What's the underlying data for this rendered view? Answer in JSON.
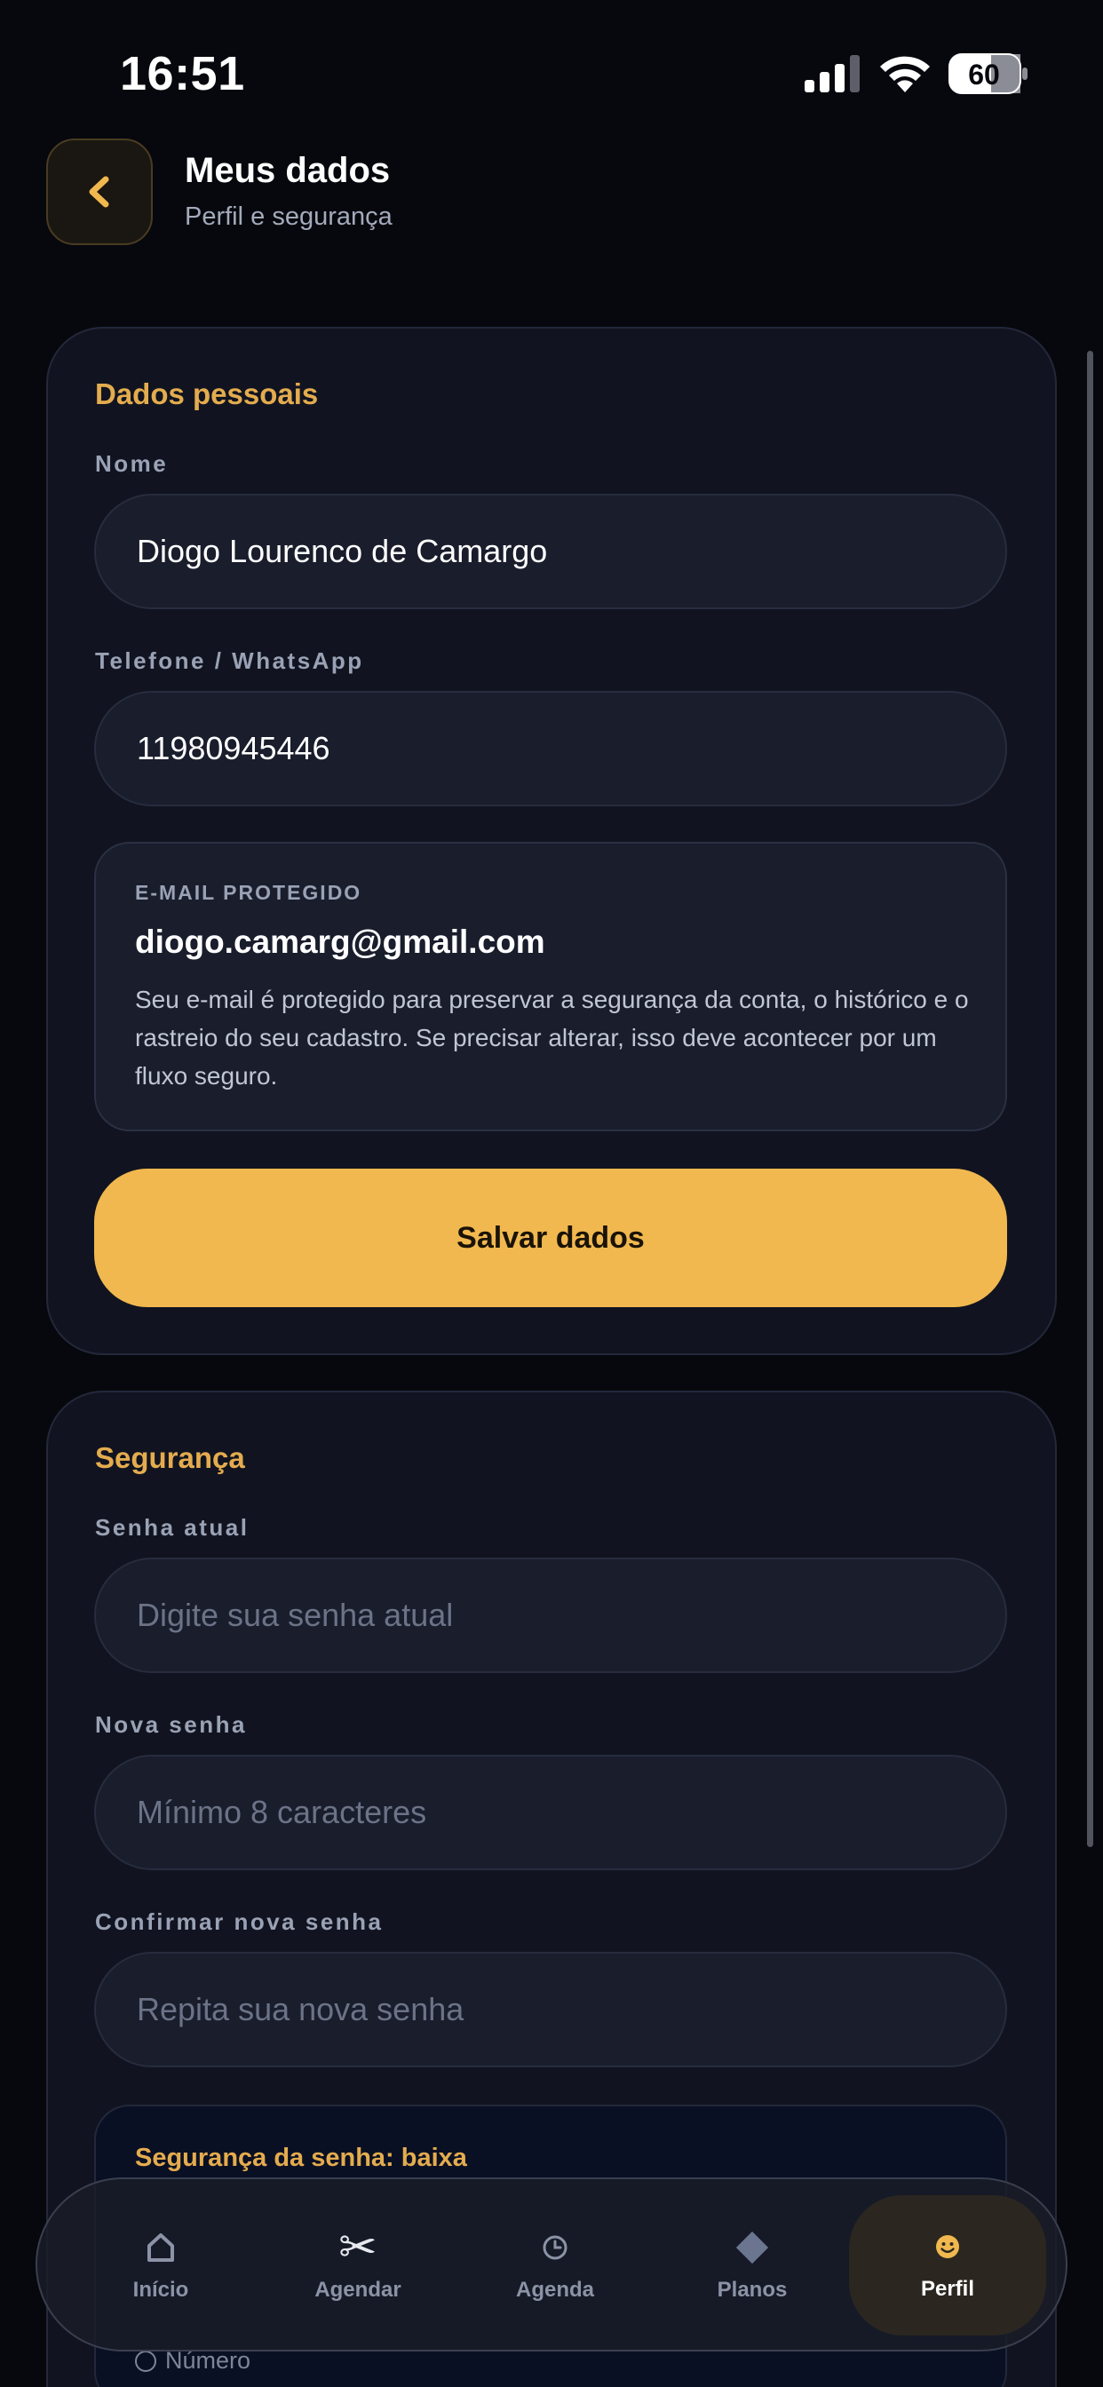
{
  "status_bar": {
    "time": "16:51",
    "battery": "60"
  },
  "header": {
    "title": "Meus dados",
    "subtitle": "Perfil e segurança"
  },
  "personal": {
    "section_title": "Dados pessoais",
    "name_label": "Nome",
    "name_value": "Diogo Lourenco de Camargo",
    "phone_label": "Telefone / WhatsApp",
    "phone_value": "11980945446",
    "email_label": "E-MAIL PROTEGIDO",
    "email_value": "diogo.camarg@gmail.com",
    "email_note": "Seu e-mail é protegido para preservar a segurança da conta, o histórico e o rastreio do seu cadastro. Se precisar alterar, isso deve acontecer por um fluxo seguro.",
    "save_label": "Salvar dados"
  },
  "security": {
    "section_title": "Segurança",
    "current_label": "Senha atual",
    "current_placeholder": "Digite sua senha atual",
    "new_label": "Nova senha",
    "new_placeholder": "Mínimo 8 caracteres",
    "confirm_label": "Confirmar nova senha",
    "confirm_placeholder": "Repita sua nova senha",
    "strength_title": "Segurança da senha: baixa",
    "requirement_visible": "Número"
  },
  "nav": {
    "items": [
      {
        "label": "Início",
        "icon": "home-icon"
      },
      {
        "label": "Agendar",
        "icon": "scissors-icon"
      },
      {
        "label": "Agenda",
        "icon": "clock-icon"
      },
      {
        "label": "Planos",
        "icon": "diamond-icon"
      },
      {
        "label": "Perfil",
        "icon": "smiley-icon"
      }
    ],
    "active_index": 4,
    "accent": "#f1b84f"
  },
  "colors": {
    "background": "#07080d",
    "card": "#111420",
    "accent": "#e4ac4e",
    "button": "#f1b84f"
  }
}
